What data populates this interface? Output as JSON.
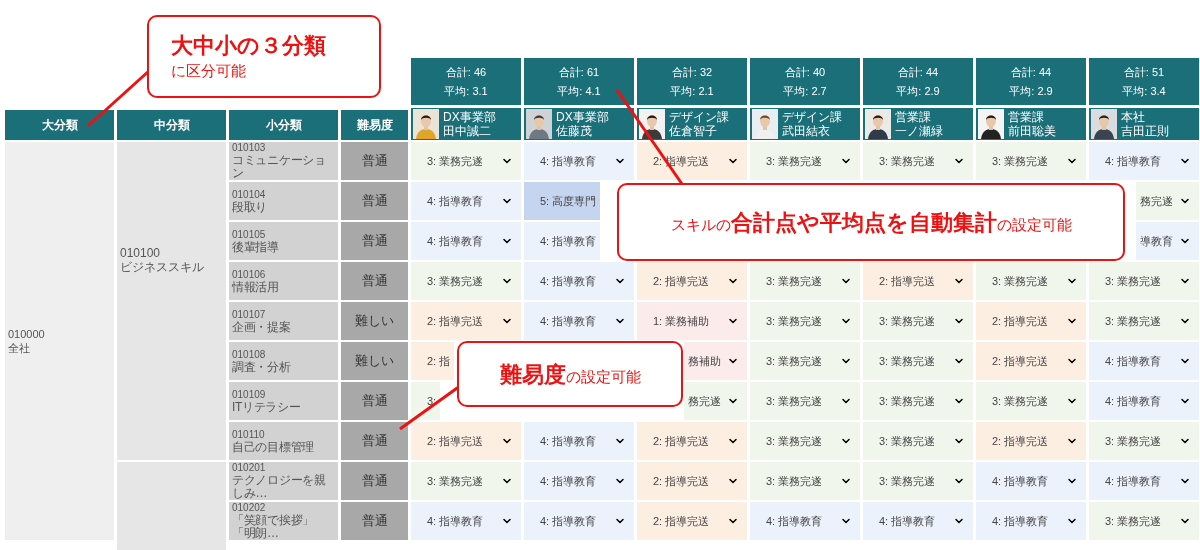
{
  "callout_categories": {
    "title": "大中小の３分類",
    "subtitle": "に区分可能"
  },
  "callout_totals": {
    "text": "スキルの**合計点や平均点を自動集計**の設定可能"
  },
  "callout_difficulty": {
    "text": "**難易度**の設定可能"
  },
  "columns": [
    "大分類",
    "中分類",
    "小分類",
    "難易度"
  ],
  "members": [
    {
      "total": "合計: 46",
      "average": "平均: 3.1",
      "dept": "DX事業部",
      "name": "田中誠二"
    },
    {
      "total": "合計: 61",
      "average": "平均: 4.1",
      "dept": "DX事業部",
      "name": "佐藤茂"
    },
    {
      "total": "合計: 32",
      "average": "平均: 2.1",
      "dept": "デザイン課",
      "name": "佐倉智子"
    },
    {
      "total": "合計: 40",
      "average": "平均: 2.7",
      "dept": "デザイン課",
      "name": "武田結衣"
    },
    {
      "total": "合計: 44",
      "average": "平均: 2.9",
      "dept": "営業課",
      "name": "一ノ瀬緑"
    },
    {
      "total": "合計: 44",
      "average": "平均: 2.9",
      "dept": "営業課",
      "name": "前田聡美"
    },
    {
      "total": "合計: 51",
      "average": "平均: 3.4",
      "dept": "本社",
      "name": "吉田正則"
    }
  ],
  "major": {
    "code": "010000",
    "name": "全社"
  },
  "middle_groups": [
    {
      "code": "010100",
      "name": "ビジネススキル",
      "skills": [
        {
          "code": "010103",
          "name": "コミュニケーション",
          "difficulty": "普通",
          "cells": [
            {
              "kind": "full",
              "text": "3: 業務完遂",
              "color": "#f1f6ec"
            },
            {
              "kind": "full",
              "text": "4: 指導教育",
              "color": "#ecf2fc"
            },
            {
              "kind": "full",
              "text": "2: 指導完送",
              "color": "#fdeee2"
            },
            {
              "kind": "full",
              "text": "3: 業務完遂",
              "color": "#f1f6ec"
            },
            {
              "kind": "full",
              "text": "3: 業務完遂",
              "color": "#f1f6ec"
            },
            {
              "kind": "full",
              "text": "3: 業務完遂",
              "color": "#f1f6ec"
            },
            {
              "kind": "full",
              "text": "4: 指導教育",
              "color": "#ecf2fc"
            }
          ]
        },
        {
          "code": "010104",
          "name": "段取り",
          "difficulty": "普通",
          "cells": [
            {
              "kind": "full",
              "text": "4: 指導教育",
              "color": "#ecf2fc"
            },
            {
              "kind": "cut_right",
              "text": "5: 高度専門",
              "color": "#c5d5f0"
            },
            {
              "kind": "hidden"
            },
            {
              "kind": "hidden"
            },
            {
              "kind": "hidden"
            },
            {
              "kind": "hidden"
            },
            {
              "kind": "cut_left",
              "text": "務完遂",
              "color": "#f1f6ec"
            }
          ]
        },
        {
          "code": "010105",
          "name": "後輩指導",
          "difficulty": "普通",
          "cells": [
            {
              "kind": "full",
              "text": "4: 指導教育",
              "color": "#ecf2fc"
            },
            {
              "kind": "cut_right",
              "text": "4: 指導教育",
              "color": "#ecf2fc"
            },
            {
              "kind": "hidden"
            },
            {
              "kind": "hidden"
            },
            {
              "kind": "hidden"
            },
            {
              "kind": "hidden"
            },
            {
              "kind": "cut_left",
              "text": "導教育",
              "color": "#ecf2fc"
            }
          ]
        },
        {
          "code": "010106",
          "name": "情報活用",
          "difficulty": "普通",
          "cells": [
            {
              "kind": "full",
              "text": "3: 業務完遂",
              "color": "#f1f6ec"
            },
            {
              "kind": "full",
              "text": "4: 指導教育",
              "color": "#ecf2fc"
            },
            {
              "kind": "full",
              "text": "2: 指導完送",
              "color": "#fdeee2"
            },
            {
              "kind": "full",
              "text": "3: 業務完遂",
              "color": "#f1f6ec"
            },
            {
              "kind": "full",
              "text": "2: 指導完送",
              "color": "#fdeee2"
            },
            {
              "kind": "full",
              "text": "3: 業務完遂",
              "color": "#f1f6ec"
            },
            {
              "kind": "full",
              "text": "3: 業務完遂",
              "color": "#f1f6ec"
            }
          ]
        },
        {
          "code": "010107",
          "name": "企画・提案",
          "difficulty": "難しい",
          "cells": [
            {
              "kind": "full",
              "text": "2: 指導完送",
              "color": "#fdeee2"
            },
            {
              "kind": "full",
              "text": "4: 指導教育",
              "color": "#ecf2fc"
            },
            {
              "kind": "full",
              "text": "1: 業務補助",
              "color": "#fcebeb"
            },
            {
              "kind": "full",
              "text": "3: 業務完遂",
              "color": "#f1f6ec"
            },
            {
              "kind": "full",
              "text": "3: 業務完遂",
              "color": "#f1f6ec"
            },
            {
              "kind": "full",
              "text": "2: 指導完送",
              "color": "#fdeee2"
            },
            {
              "kind": "full",
              "text": "3: 業務完遂",
              "color": "#f1f6ec"
            }
          ]
        },
        {
          "code": "010108",
          "name": "調査・分析",
          "difficulty": "難しい",
          "cells": [
            {
              "kind": "cut_right",
              "text": "2: 指",
              "color": "#fdeee2"
            },
            {
              "kind": "hidden"
            },
            {
              "kind": "cut_left",
              "text": "務補助",
              "color": "#fcebeb"
            },
            {
              "kind": "full",
              "text": "3: 業務完遂",
              "color": "#f1f6ec"
            },
            {
              "kind": "full",
              "text": "3: 業務完遂",
              "color": "#f1f6ec"
            },
            {
              "kind": "full",
              "text": "2: 指導完送",
              "color": "#fdeee2"
            },
            {
              "kind": "full",
              "text": "4: 指導教育",
              "color": "#ecf2fc"
            }
          ]
        },
        {
          "code": "010109",
          "name": "ITリテラシー",
          "difficulty": "普通",
          "cells": [
            {
              "kind": "cut_right",
              "text": "3:",
              "color": "#f1f6ec"
            },
            {
              "kind": "hidden"
            },
            {
              "kind": "cut_left",
              "text": "務完遂",
              "color": "#f1f6ec"
            },
            {
              "kind": "full",
              "text": "3: 業務完遂",
              "color": "#f1f6ec"
            },
            {
              "kind": "full",
              "text": "3: 業務完遂",
              "color": "#f1f6ec"
            },
            {
              "kind": "full",
              "text": "3: 業務完遂",
              "color": "#f1f6ec"
            },
            {
              "kind": "full",
              "text": "4: 指導教育",
              "color": "#ecf2fc"
            }
          ]
        },
        {
          "code": "010110",
          "name": "自己の目標管理",
          "difficulty": "普通",
          "cells": [
            {
              "kind": "full",
              "text": "2: 指導完送",
              "color": "#fdeee2"
            },
            {
              "kind": "full",
              "text": "4: 指導教育",
              "color": "#ecf2fc"
            },
            {
              "kind": "full",
              "text": "2: 指導完送",
              "color": "#fdeee2"
            },
            {
              "kind": "full",
              "text": "3: 業務完遂",
              "color": "#f1f6ec"
            },
            {
              "kind": "full",
              "text": "3: 業務完遂",
              "color": "#f1f6ec"
            },
            {
              "kind": "full",
              "text": "2: 指導完送",
              "color": "#fdeee2"
            },
            {
              "kind": "full",
              "text": "3: 業務完遂",
              "color": "#f1f6ec"
            }
          ]
        }
      ]
    },
    {
      "skills": [
        {
          "code": "010201",
          "name": "テクノロジーを親しみ…",
          "difficulty": "普通",
          "cells": [
            {
              "kind": "full",
              "text": "3: 業務完遂",
              "color": "#f1f6ec"
            },
            {
              "kind": "full",
              "text": "4: 指導教育",
              "color": "#ecf2fc"
            },
            {
              "kind": "full",
              "text": "2: 指導完送",
              "color": "#fdeee2"
            },
            {
              "kind": "full",
              "text": "3: 業務完遂",
              "color": "#f1f6ec"
            },
            {
              "kind": "full",
              "text": "3: 業務完遂",
              "color": "#f1f6ec"
            },
            {
              "kind": "full",
              "text": "4: 指導教育",
              "color": "#ecf2fc"
            },
            {
              "kind": "full",
              "text": "4: 指導教育",
              "color": "#ecf2fc"
            }
          ]
        },
        {
          "code": "010202",
          "name": "「笑顔で挨拶」「明朗…",
          "difficulty": "普通",
          "cells": [
            {
              "kind": "full",
              "text": "4: 指導教育",
              "color": "#ecf2fc"
            },
            {
              "kind": "full",
              "text": "4: 指導教育",
              "color": "#ecf2fc"
            },
            {
              "kind": "full",
              "text": "2: 指導完送",
              "color": "#fdeee2"
            },
            {
              "kind": "full",
              "text": "4: 指導教育",
              "color": "#ecf2fc"
            },
            {
              "kind": "full",
              "text": "4: 指導教育",
              "color": "#ecf2fc"
            },
            {
              "kind": "full",
              "text": "4: 指導教育",
              "color": "#ecf2fc"
            },
            {
              "kind": "full",
              "text": "3: 業務完遂",
              "color": "#f1f6ec"
            }
          ]
        }
      ]
    }
  ]
}
